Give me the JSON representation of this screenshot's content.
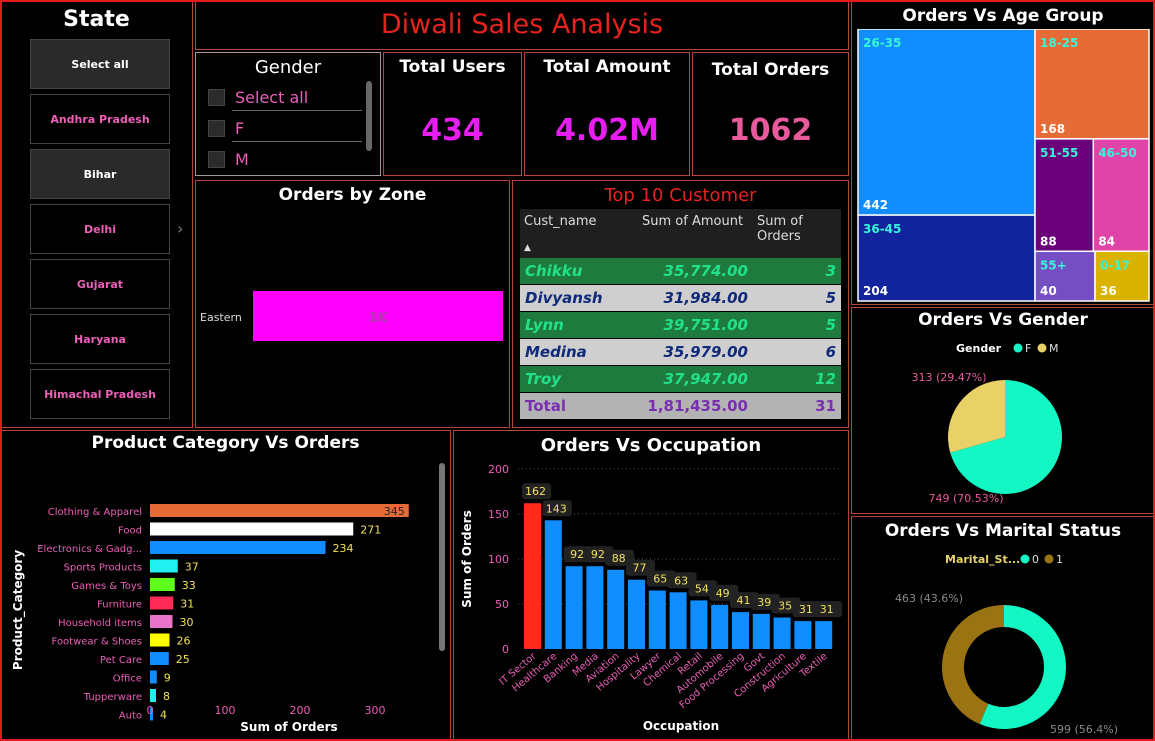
{
  "title": "Diwali Sales Analysis",
  "state_slicer": {
    "title": "State",
    "items": [
      "Select all",
      "Andhra Pradesh",
      "Bihar",
      "Delhi",
      "Gujarat",
      "Haryana",
      "Himachal Pradesh"
    ],
    "selected": [
      "Select all",
      "Bihar"
    ]
  },
  "gender_slicer": {
    "title": "Gender",
    "options": [
      "Select all",
      "F",
      "M"
    ]
  },
  "kpis": {
    "total_users": {
      "label": "Total Users",
      "value": "434",
      "color": "#e81ef0"
    },
    "total_amount": {
      "label": "Total Amount",
      "value": "4.02M",
      "color": "#e81ef0"
    },
    "total_orders": {
      "label": "Total Orders",
      "value": "1062",
      "color": "#e85a9c"
    }
  },
  "orders_by_zone": {
    "title": "Orders by Zone",
    "chart_data": {
      "type": "bar",
      "categories": [
        "Eastern"
      ],
      "values": [
        1000
      ],
      "data_labels": [
        "1K"
      ],
      "color": "#ff00ff"
    }
  },
  "top_customers": {
    "title": "Top 10 Customer",
    "headers": [
      "Cust_name",
      "Sum of Amount",
      "Sum of Orders"
    ],
    "rows": [
      [
        "Chikku",
        "35,774.00",
        "3"
      ],
      [
        "Divyansh",
        "31,984.00",
        "5"
      ],
      [
        "Lynn",
        "39,751.00",
        "5"
      ],
      [
        "Medina",
        "35,979.00",
        "6"
      ],
      [
        "Troy",
        "37,947.00",
        "12"
      ]
    ],
    "total": [
      "Total",
      "1,81,435.00",
      "31"
    ]
  },
  "age_group": {
    "title": "Orders Vs Age Group",
    "chart_data": {
      "type": "treemap",
      "categories": [
        "26-35",
        "18-25",
        "36-45",
        "51-55",
        "46-50",
        "55+",
        "0-17"
      ],
      "values": [
        442,
        168,
        204,
        88,
        84,
        40,
        36
      ],
      "colors": [
        "#118dff",
        "#e66c37",
        "#12239e",
        "#6b007b",
        "#e044a7",
        "#744ec2",
        "#d9b300"
      ]
    }
  },
  "gender_chart": {
    "title": "Orders Vs Gender",
    "legend_title": "Gender",
    "chart_data": {
      "type": "pie",
      "categories": [
        "F",
        "M"
      ],
      "values": [
        749,
        313
      ],
      "labels": [
        "749 (70.53%)",
        "313 (29.47%)"
      ],
      "colors": [
        "#13f7c5",
        "#e8d166"
      ]
    }
  },
  "marital_chart": {
    "title": "Orders Vs Marital Status",
    "legend_title": "Marital_St...",
    "chart_data": {
      "type": "donut",
      "categories": [
        "0",
        "1"
      ],
      "values": [
        599,
        463
      ],
      "labels": [
        "599 (56.4%)",
        "463 (43.6%)"
      ],
      "colors": [
        "#13f7c5",
        "#9a7412"
      ]
    }
  },
  "product_category": {
    "title": "Product Category Vs Orders",
    "xlabel": "Sum of Orders",
    "ylabel": "Product_Category",
    "chart_data": {
      "type": "bar",
      "orientation": "horizontal",
      "categories": [
        "Clothing & Apparel",
        "Food",
        "Electronics & Gadg...",
        "Sports Products",
        "Games & Toys",
        "Furniture",
        "Household items",
        "Footwear & Shoes",
        "Pet Care",
        "Office",
        "Tupperware",
        "Auto"
      ],
      "values": [
        345,
        271,
        234,
        37,
        33,
        31,
        30,
        26,
        25,
        9,
        8,
        4
      ],
      "colors": [
        "#e66c37",
        "#ffffff",
        "#118dff",
        "#21f0f0",
        "#5fff1c",
        "#ff2a55",
        "#e873c8",
        "#ffff00",
        "#118dff",
        "#118dff",
        "#21f0f0",
        "#118dff"
      ],
      "xticks": [
        0,
        100,
        200,
        300
      ],
      "xlim": [
        0,
        390
      ]
    }
  },
  "occupation": {
    "title": "Orders Vs Occupation",
    "xlabel": "Occupation",
    "ylabel": "Sum of Orders",
    "chart_data": {
      "type": "bar",
      "categories": [
        "IT Sector",
        "Healthcare",
        "Banking",
        "Media",
        "Aviation",
        "Hospitality",
        "Lawyer",
        "Chemical",
        "Retail",
        "Automobile",
        "Food Processing",
        "Govt",
        "Construction",
        "Agriculture",
        "Textile"
      ],
      "values": [
        162,
        143,
        92,
        92,
        88,
        77,
        65,
        63,
        54,
        49,
        41,
        39,
        35,
        31,
        31
      ],
      "colors": [
        "#ff2a1a",
        "#118dff",
        "#118dff",
        "#118dff",
        "#118dff",
        "#118dff",
        "#118dff",
        "#118dff",
        "#118dff",
        "#118dff",
        "#118dff",
        "#118dff",
        "#118dff",
        "#118dff",
        "#118dff"
      ],
      "yticks": [
        0,
        50,
        100,
        150,
        200
      ],
      "ylim": [
        0,
        200
      ]
    }
  }
}
